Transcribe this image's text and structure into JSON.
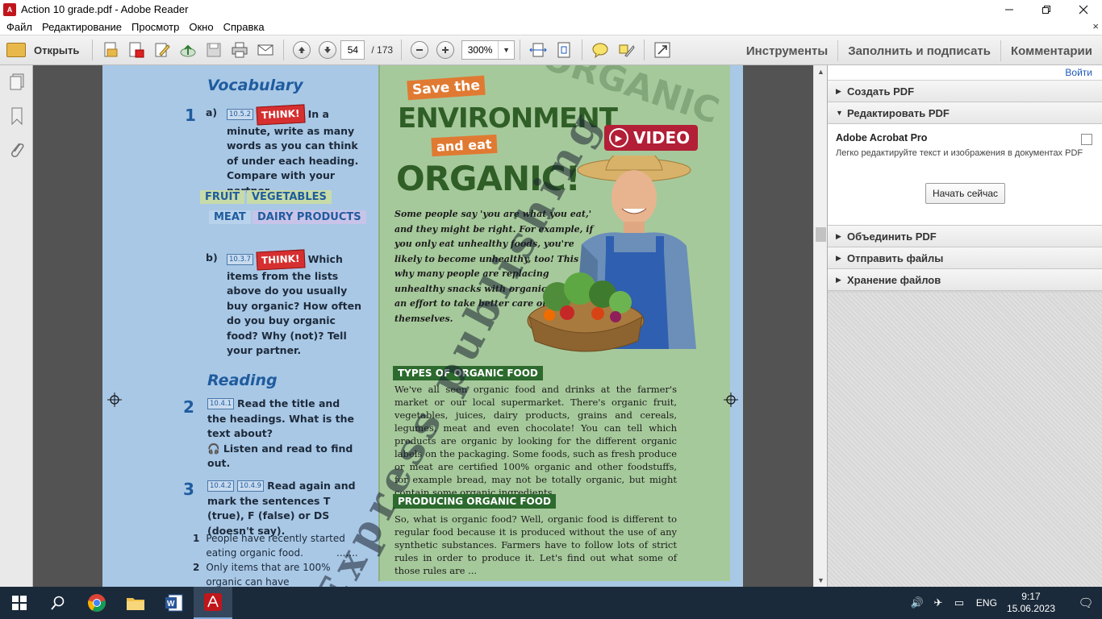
{
  "window": {
    "title": "Action 10 grade.pdf - Adobe Reader",
    "logo_text": "A"
  },
  "menu": {
    "items": [
      "Файл",
      "Редактирование",
      "Просмотр",
      "Окно",
      "Справка"
    ],
    "close_glyph": "×"
  },
  "toolbar": {
    "open_label": "Открыть",
    "page_current": "54",
    "page_total": "/ 173",
    "zoom": "300%",
    "tools_label": "Инструменты",
    "fill_sign_label": "Заполнить и подписать",
    "comments_label": "Комментарии"
  },
  "document": {
    "vocabulary_title": "Vocabulary",
    "task1_num": "1",
    "task1a_letter": "a)",
    "task1a_code": "10.5.2",
    "think": "THINK!",
    "task1a_text": "In a minute, write as many words as you can think of under each heading. Compare with your partner.",
    "cat_fruit": "FRUIT",
    "cat_vegetables": "VEGETABLES",
    "cat_meat": "MEAT",
    "cat_dairy": "DAIRY PRODUCTS",
    "task1b_letter": "b)",
    "task1b_code": "10.3.7",
    "task1b_text": "Which items from the lists above do you usually buy organic? How often do you buy organic food? Why (not)? Tell your partner.",
    "reading_title": "Reading",
    "task2_num": "2",
    "task2_code": "10.4.1",
    "task2_text": "Read the title and the headings. What is the text about?",
    "task2_listen": "Listen and read to find out.",
    "task3_num": "3",
    "task3_code1": "10.4.2",
    "task3_code2": "10.4.9",
    "task3_text": "Read again and mark the sentences T (true), F (false) or DS (doesn't say).",
    "list": [
      {
        "num": "1",
        "text": "People have recently started eating organic food.",
        "blank": "......."
      },
      {
        "num": "2",
        "text": "Only items that are 100% organic can have",
        "blank": ""
      }
    ],
    "save_the": "Save the",
    "environment": "ENVIRONMENT",
    "and_eat": "and eat",
    "organic": "ORGANIC!",
    "video": "VIDEO",
    "stamp": "ORGANIC",
    "intro": "Some people say 'you are what you eat,' and they might be right. For example, if you only eat unhealthy foods, you're likely to become unhealthy, too! This is why many people are replacing unhealthy snacks with organic foods in an effort to take better care of themselves.",
    "types_heading": "TYPES OF ORGANIC FOOD",
    "types_text": "We've all seen organic food and drinks at the farmer's market or our local supermarket. There's organic fruit, vegetables, juices, dairy products, grains and cereals, legumes, meat and even chocolate! You can tell which products are organic by looking for the different organic labels on the packaging. Some foods, such as fresh produce or meat are certified 100% organic and other foodstuffs, for example bread, may not be totally organic, but might contain some organic ingredients.",
    "producing_heading": "PRODUCING ORGANIC FOOD",
    "producing_text": "So, what is organic food? Well, organic food is different to regular food because it is produced without the use of any synthetic substances. Farmers have to follow lots of strict rules in order to produce it. Let's find out what some of those rules are ...",
    "watermark": "Express publishing"
  },
  "rightpane": {
    "signin": "Войти",
    "create_pdf": "Создать PDF",
    "edit_pdf": "Редактировать PDF",
    "acrobat_title": "Adobe Acrobat Pro",
    "acrobat_desc": "Легко редактируйте текст и изображения в документах PDF",
    "start_button": "Начать сейчас",
    "combine_pdf": "Объединить PDF",
    "send_files": "Отправить файлы",
    "store_files": "Хранение файлов"
  },
  "taskbar": {
    "lang": "ENG",
    "time": "9:17",
    "date": "15.06.2023"
  },
  "colors": {
    "page_blue": "#a9c8e6",
    "page_green": "#a6c99b",
    "heading_blue": "#1f5c9e",
    "organic_green": "#2f5e26",
    "accent_orange": "#e07a32",
    "think_red": "#d62f2f",
    "taskbar": "#1b2a3a"
  }
}
